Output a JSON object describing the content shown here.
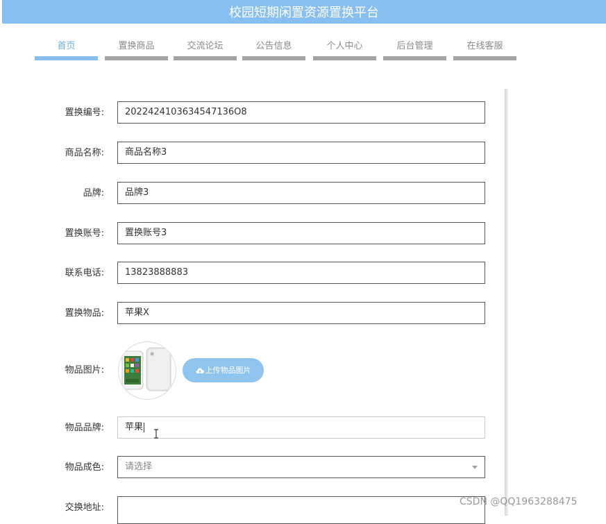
{
  "header": {
    "title": "校园短期闲置资源置换平台"
  },
  "nav": [
    {
      "label": "首页"
    },
    {
      "label": "置换商品"
    },
    {
      "label": "交流论坛"
    },
    {
      "label": "公告信息"
    },
    {
      "label": "个人中心"
    },
    {
      "label": "后台管理"
    },
    {
      "label": "在线客服"
    }
  ],
  "colors": {
    "accent": "#87bff0",
    "nav_inactive": "#a3a3a3",
    "button": "#8ec4ee"
  },
  "form": {
    "exchange_no": {
      "label": "置换编号:",
      "value": "2022424103634547136O8"
    },
    "product_name": {
      "label": "商品名称:",
      "value": "商品名称3"
    },
    "brand": {
      "label": "品牌:",
      "value": "品牌3"
    },
    "exchange_account": {
      "label": "置换账号:",
      "value": "置换账号3"
    },
    "phone": {
      "label": "联系电话:",
      "value": "13823888883"
    },
    "exchange_item": {
      "label": "置换物品:",
      "value": "苹果X"
    },
    "item_image": {
      "label": "物品图片:",
      "upload_label": "上传物品图片",
      "upload_icon": "cloud-upload-icon"
    },
    "item_brand": {
      "label": "物品品牌:",
      "value": "苹果"
    },
    "item_condition": {
      "label": "物品成色:",
      "placeholder": "请选择"
    },
    "exchange_address": {
      "label": "交换地址:",
      "value": ""
    }
  },
  "watermark": "CSDN @QQ1963288475"
}
